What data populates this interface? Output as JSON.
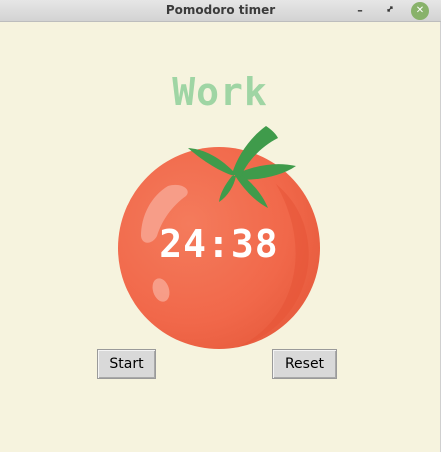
{
  "window": {
    "title": "Pomodoro timer",
    "controls": {
      "minimize_icon": "minimize-icon",
      "maximize_icon": "maximize-icon",
      "close_icon": "close-icon"
    }
  },
  "timer": {
    "mode_label": "Work",
    "time_display": "24:38"
  },
  "buttons": {
    "start_label": "Start",
    "reset_label": "Reset"
  },
  "colors": {
    "background": "#f6f3de",
    "mode_label": "#9fd5a4",
    "tomato": "#f26a4b",
    "leaves": "#3f9b4b",
    "close_button": "#88b26a"
  }
}
